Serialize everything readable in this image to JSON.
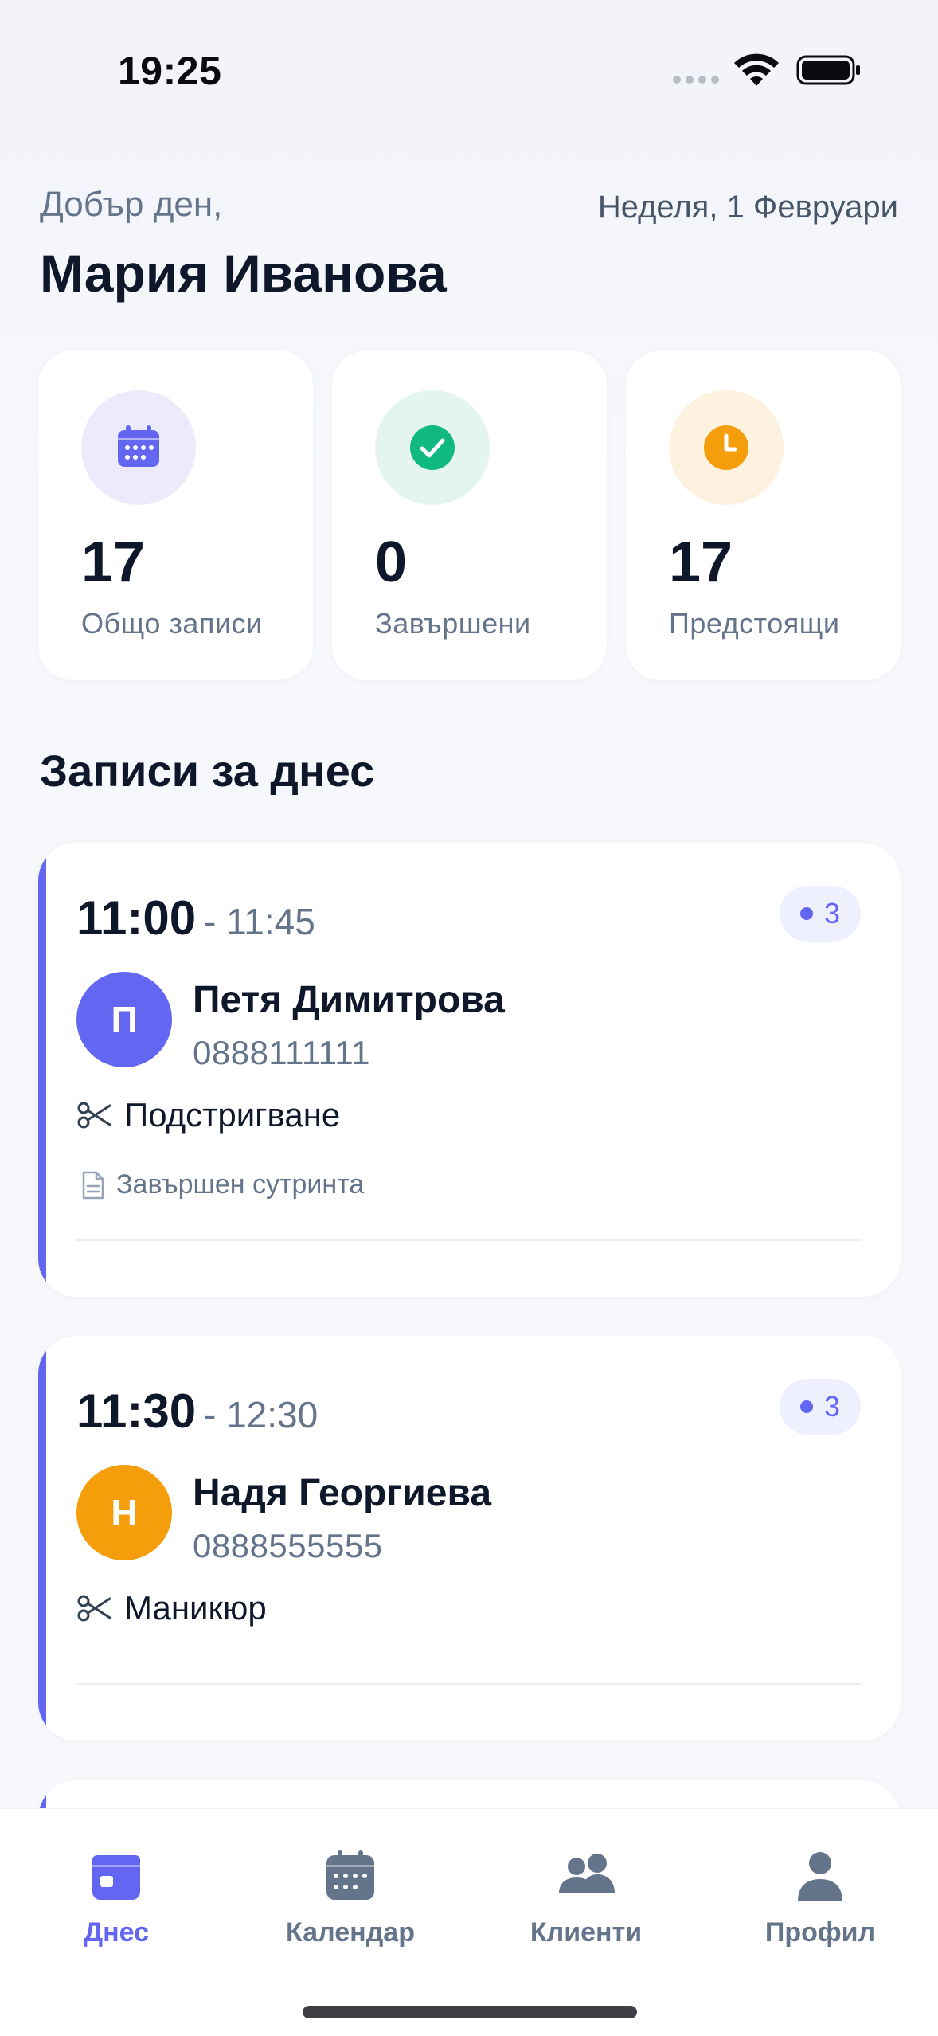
{
  "status_bar": {
    "time": "19:25"
  },
  "header": {
    "greeting": "Добър ден,",
    "user_name": "Мария Иванова",
    "date": "Неделя, 1 Февруари"
  },
  "stats": [
    {
      "value": "17",
      "label": "Общо записи",
      "icon": "calendar-icon",
      "color": "#6366f1",
      "bg": "#ecebfb"
    },
    {
      "value": "0",
      "label": "Завършени",
      "icon": "check-circle-icon",
      "color": "#10b981",
      "bg": "#e3f5ee"
    },
    {
      "value": "17",
      "label": "Предстоящи",
      "icon": "clock-icon",
      "color": "#f59e0b",
      "bg": "#fdf1e0"
    }
  ],
  "section_title": "Записи за днес",
  "appointments": [
    {
      "start": "11:00",
      "end": "- 11:45",
      "badge": "3",
      "initial": "П",
      "avatar_color": "#6366f1",
      "client": "Петя Димитрова",
      "phone": "0888111111",
      "service": "Подстригване",
      "note": "Завършен сутринта"
    },
    {
      "start": "11:30",
      "end": "- 12:30",
      "badge": "3",
      "initial": "Н",
      "avatar_color": "#f59e0b",
      "client": "Надя Георгиева",
      "phone": "0888555555",
      "service": "Маникюр"
    }
  ],
  "tabs": [
    {
      "label": "Днес",
      "icon": "today-icon",
      "active": true
    },
    {
      "label": "Календар",
      "icon": "calendar-icon",
      "active": false
    },
    {
      "label": "Клиенти",
      "icon": "users-icon",
      "active": false
    },
    {
      "label": "Профил",
      "icon": "profile-icon",
      "active": false
    }
  ],
  "colors": {
    "accent": "#6366f1",
    "muted": "#64748b",
    "text": "#0f172a"
  }
}
